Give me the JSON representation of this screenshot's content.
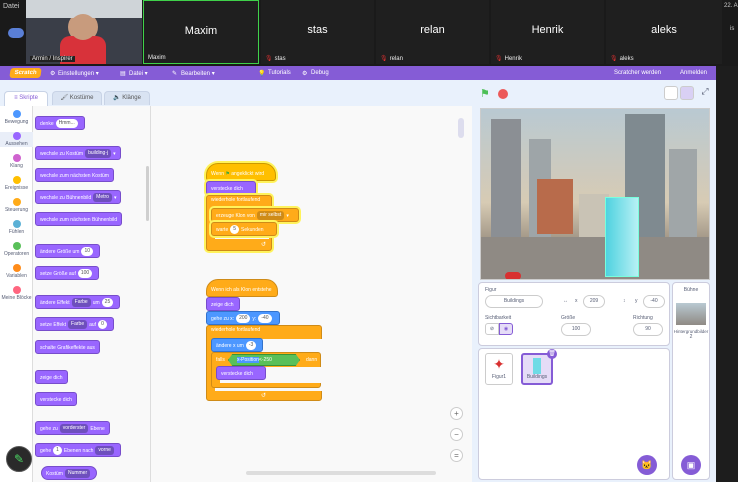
{
  "os": {
    "left_label": "Datei",
    "right_label": "22. A",
    "right_label2": "is"
  },
  "video": {
    "tiles": [
      {
        "name": "",
        "label": "Armin / Inspirer"
      },
      {
        "name": "Maxim",
        "label": "Maxim"
      },
      {
        "name": "stas",
        "label": "stas"
      },
      {
        "name": "relan",
        "label": "relan"
      },
      {
        "name": "Henrik",
        "label": "Henrik"
      },
      {
        "name": "aleks",
        "label": "aleks"
      }
    ]
  },
  "menu": {
    "logo": "Scratch",
    "settings": "Einstellungen",
    "file": "Datei",
    "edit": "Bearbeiten",
    "tutorials": "Tutorials",
    "debug": "Debug",
    "become_scratcher": "Scratcher werden",
    "login": "Anmelden"
  },
  "tabs": {
    "code": "Skripte",
    "costumes": "Kostüme",
    "sounds": "Klänge"
  },
  "categories": [
    {
      "label": "Bewegung",
      "color": "#4c97ff"
    },
    {
      "label": "Aussehen",
      "color": "#9966ff"
    },
    {
      "label": "Klang",
      "color": "#cf63cf"
    },
    {
      "label": "Ereignisse",
      "color": "#ffbf00"
    },
    {
      "label": "Steuerung",
      "color": "#ffab19"
    },
    {
      "label": "Fühlen",
      "color": "#5cb1d6"
    },
    {
      "label": "Operatoren",
      "color": "#59c059"
    },
    {
      "label": "Variablen",
      "color": "#ff8c1a"
    },
    {
      "label": "Meine Blöcke",
      "color": "#ff6680"
    }
  ],
  "palette": {
    "think": "denke",
    "think_val": "Hmm...",
    "switch_costume": "wechsle zu Kostüm",
    "costume_val": "building-j",
    "next_costume": "wechsle zum nächsten Kostüm",
    "switch_backdrop": "wechsle zu Bühnenbild",
    "backdrop_val": "Metro",
    "next_backdrop": "wechsle zum nächsten Bühnenbild",
    "change_size": "ändere Größe um",
    "change_size_val": "10",
    "set_size": "setze Größe auf",
    "set_size_val": "100",
    "change_effect": "ändere Effekt",
    "effect_val": "Farbe",
    "um": "um",
    "change_effect_val": "25",
    "set_effect": "setze Effekt",
    "effect_val2": "Farbe",
    "auf": "auf",
    "set_effect_val": "0",
    "clear_effects": "schalte Grafikeffekte aus",
    "show": "zeige dich",
    "hide": "verstecke dich",
    "goto_layer": "gehe zu",
    "layer_val": "vorderster",
    "layer": "Ebene",
    "go_layers": "gehe",
    "go_layers_val": "1",
    "layers_mid": "Ebenen nach",
    "dir_val": "vorne",
    "costume": "Kostüm",
    "costume_prop": "Nummer"
  },
  "script1": {
    "hat": "Wenn",
    "flag": "⚑",
    "hat2": "angeklickt wird",
    "hide": "verstecke dich",
    "forever": "wiederhole fortlaufend",
    "clone": "erzeuge Klon von",
    "clone_val": "mir selbst",
    "wait": "warte",
    "wait_val": "5",
    "wait_unit": "Sekunden"
  },
  "script2": {
    "hat": "Wenn ich als Klon entstehe",
    "show": "zeige dich",
    "goto": "gehe zu x:",
    "goto_x": "200",
    "y": "y:",
    "goto_y": "-40",
    "forever": "wiederhole fortlaufend",
    "change_x": "ändere x um",
    "change_x_val": "-3",
    "if": "falls",
    "xpos": "x-Position",
    "lt": "<",
    "lt_val": "-250",
    "then": "dann",
    "hide": "verstecke dich"
  },
  "sprite_info": {
    "label": "Figur",
    "name": "Buildings",
    "x_label": "x",
    "x": "209",
    "y_label": "y",
    "y": "-40",
    "visible": "Sichtbarkeit",
    "size_label": "Größe",
    "size": "100",
    "dir_label": "Richtung",
    "dir": "90"
  },
  "sprites": [
    {
      "name": "Figur1"
    },
    {
      "name": "Buildings"
    }
  ],
  "stage_panel": {
    "title": "Bühne",
    "bg_label": "Hintergrundbilder",
    "bg_count": "2"
  }
}
